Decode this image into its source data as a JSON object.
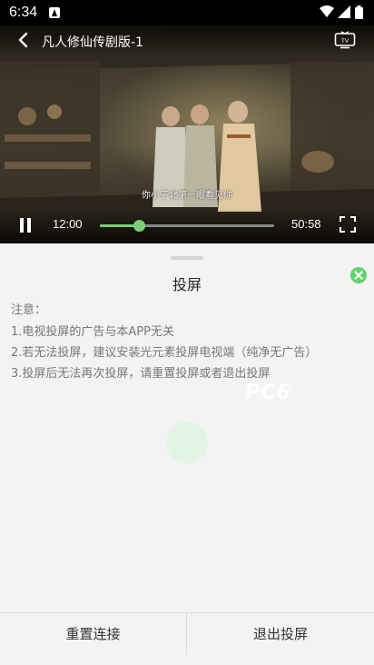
{
  "status_bar": {
    "time": "6:34"
  },
  "player": {
    "title": "凡人修仙传剧版-1",
    "subtitle": "你小子北第一眼看见你",
    "current_time": "12:00",
    "total_time": "50:58",
    "progress": 0.224
  },
  "cast_sheet": {
    "title": "投屏",
    "notice_heading": "注意：",
    "notices": [
      "1.电视投屏的广告与本APP无关",
      "2.若无法投屏，建议安装光元素投屏电视端（纯净无广告）",
      "3.投屏后无法再次投屏，请重置投屏或者退出投屏"
    ],
    "reset_label": "重置连接",
    "exit_label": "退出投屏"
  },
  "watermark": "PC6",
  "colors": {
    "accent": "#63d26c",
    "progress": "#7ad07a",
    "sheet_bg": "#f3f3f3"
  }
}
